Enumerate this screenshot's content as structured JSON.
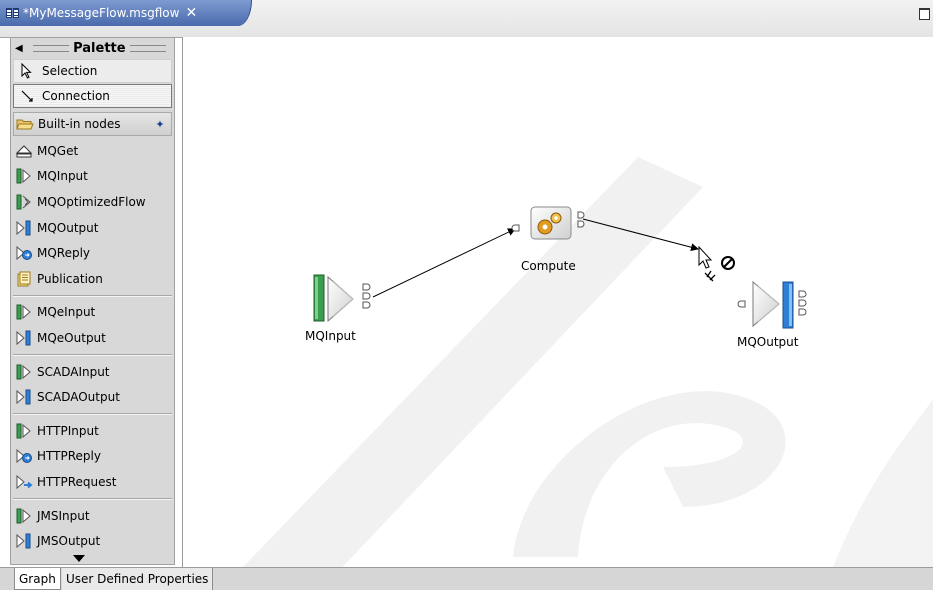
{
  "editor": {
    "tab_title": "*MyMessageFlow.msgflow",
    "close_glyph": "✕"
  },
  "palette": {
    "title": "Palette",
    "tools": [
      {
        "label": "Selection",
        "icon": "arrow-pointer-icon"
      },
      {
        "label": "Connection",
        "icon": "connection-pointer-icon"
      }
    ],
    "drawer": {
      "label": "Built-in nodes",
      "icon": "folder-open-icon",
      "pin": "pin-icon"
    },
    "nodes": [
      {
        "label": "MQGet",
        "icon": "mqget-icon"
      },
      {
        "label": "MQInput",
        "icon": "input-node-icon"
      },
      {
        "label": "MQOptimizedFlow",
        "icon": "optimized-flow-icon"
      },
      {
        "label": "MQOutput",
        "icon": "output-node-icon"
      },
      {
        "label": "MQReply",
        "icon": "reply-node-icon"
      },
      {
        "label": "Publication",
        "icon": "publication-icon"
      },
      {
        "label": "MQeInput",
        "icon": "input-node-icon"
      },
      {
        "label": "MQeOutput",
        "icon": "output-node-icon"
      },
      {
        "label": "SCADAInput",
        "icon": "input-node-icon"
      },
      {
        "label": "SCADAOutput",
        "icon": "output-node-icon"
      },
      {
        "label": "HTTPInput",
        "icon": "input-node-icon"
      },
      {
        "label": "HTTPReply",
        "icon": "reply-node-icon"
      },
      {
        "label": "HTTPRequest",
        "icon": "request-node-icon"
      },
      {
        "label": "JMSInput",
        "icon": "input-node-icon"
      },
      {
        "label": "JMSOutput",
        "icon": "output-node-icon"
      }
    ]
  },
  "flow": {
    "nodes": [
      {
        "label": "MQInput",
        "icon": "input-node-icon"
      },
      {
        "label": "Compute",
        "icon": "compute-gears-icon"
      },
      {
        "label": "MQOutput",
        "icon": "output-node-icon"
      }
    ],
    "cursor": {
      "icon": "connection-cursor-icon",
      "status": "not-allowed-icon"
    }
  },
  "bottom_tabs": [
    {
      "label": "Graph",
      "selected": true
    },
    {
      "label": "User Defined Properties",
      "selected": false
    }
  ],
  "colors": {
    "tab_active": "#4a6aad",
    "input_node_bar": "#3b9d4f",
    "output_node_bar": "#2f7fd6",
    "watermark": "#efefef"
  }
}
